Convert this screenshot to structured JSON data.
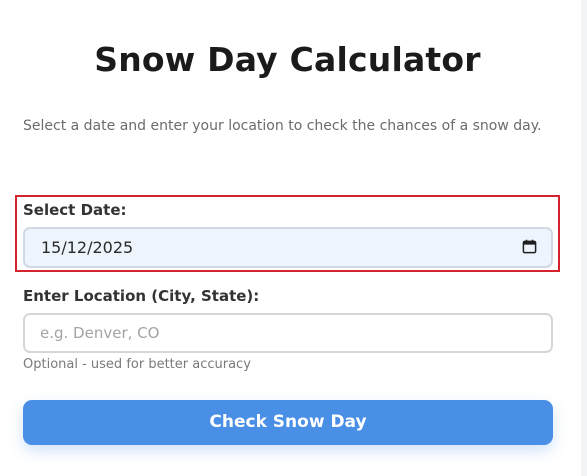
{
  "header": {
    "title": "Snow Day Calculator",
    "subtitle": "Select a date and enter your location to check the chances of a snow day."
  },
  "date_field": {
    "label": "Select Date:",
    "value": "15/12/2025",
    "icon": "calendar-icon"
  },
  "location_field": {
    "label": "Enter Location (City, State):",
    "placeholder": "e.g. Denver, CO",
    "hint": "Optional - used for better accuracy"
  },
  "submit": {
    "label": "Check Snow Day"
  },
  "colors": {
    "accent": "#4a8fe6",
    "highlight_border": "#d4232e",
    "date_background": "#eef4fc"
  }
}
